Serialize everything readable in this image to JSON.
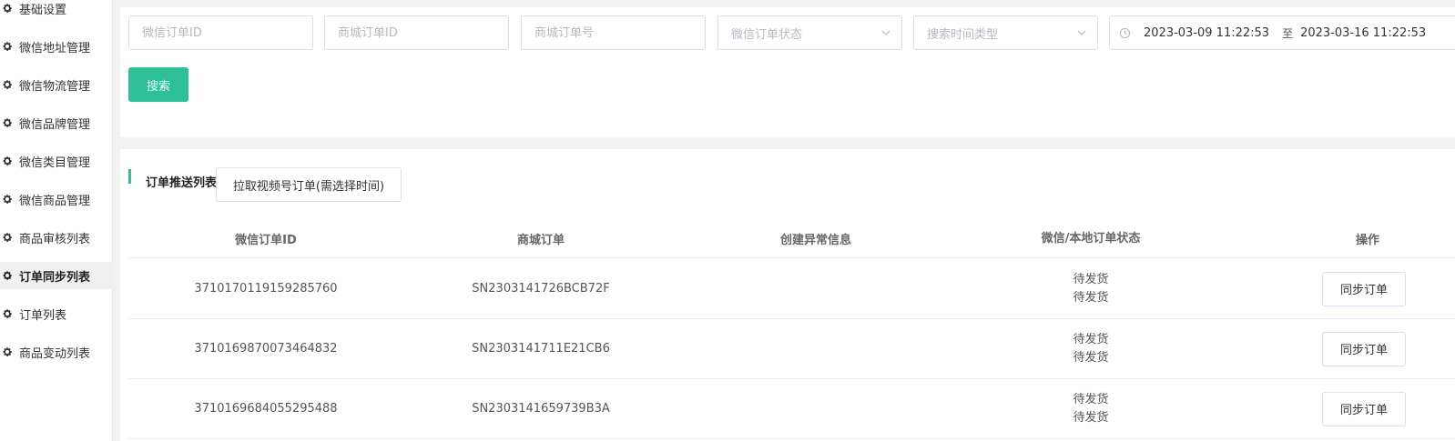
{
  "sidebar": {
    "items": [
      {
        "label": "基础设置",
        "active": false
      },
      {
        "label": "微信地址管理",
        "active": false
      },
      {
        "label": "微信物流管理",
        "active": false
      },
      {
        "label": "微信品牌管理",
        "active": false
      },
      {
        "label": "微信类目管理",
        "active": false
      },
      {
        "label": "微信商品管理",
        "active": false
      },
      {
        "label": "商品审核列表",
        "active": false
      },
      {
        "label": "订单同步列表",
        "active": true
      },
      {
        "label": "订单列表",
        "active": false
      },
      {
        "label": "商品变动列表",
        "active": false
      }
    ],
    "icon": "gear-icon"
  },
  "search": {
    "wx_order_id_placeholder": "微信订单ID",
    "mall_order_id_placeholder": "商城订单ID",
    "mall_order_no_placeholder": "商城订单号",
    "wx_order_status_placeholder": "微信订单状态",
    "time_type_placeholder": "搜索时间类型",
    "date_start": "2023-03-09 11:22:53",
    "date_separator": "至",
    "date_end": "2023-03-16 11:22:53",
    "search_label": "搜索"
  },
  "list": {
    "title": "订单推送列表",
    "pull_button_label": "拉取视频号订单(需选择时间)",
    "columns": [
      "微信订单ID",
      "商城订单",
      "创建异常信息",
      "微信/本地订单状态",
      "操作"
    ],
    "rows": [
      {
        "wx_order_id": "3710170119159285760",
        "mall_order": "SN2303141726BCB72F",
        "error": "",
        "wx_status": "待发货",
        "local_status": "待发货",
        "action": "同步订单"
      },
      {
        "wx_order_id": "3710169870073464832",
        "mall_order": "SN2303141711E21CB6",
        "error": "",
        "wx_status": "待发货",
        "local_status": "待发货",
        "action": "同步订单"
      },
      {
        "wx_order_id": "3710169684055295488",
        "mall_order": "SN2303141659739B3A",
        "error": "",
        "wx_status": "待发货",
        "local_status": "待发货",
        "action": "同步订单"
      }
    ]
  },
  "colors": {
    "accent": "#2fbf97"
  }
}
